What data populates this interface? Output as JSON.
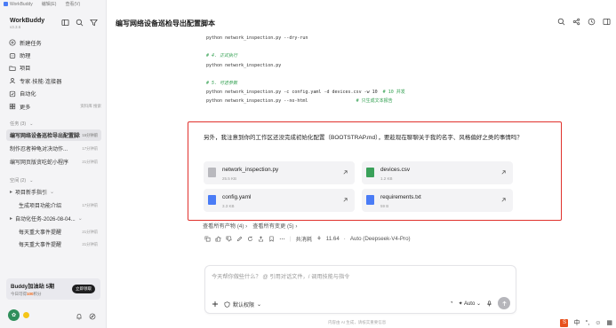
{
  "menubar": {
    "app": "WorkBuddy",
    "edit": "编辑(E)",
    "view": "查看(V)"
  },
  "brand": {
    "name": "WorkBuddy",
    "version": "v3.3.6"
  },
  "nav": [
    {
      "label": "新建任务"
    },
    {
      "label": "助理"
    },
    {
      "label": "项目"
    },
    {
      "label": "专家·技能·连接器"
    },
    {
      "label": "自动化"
    },
    {
      "label": "更多",
      "right": "资料库  搜索"
    }
  ],
  "tasks_header": "任务 (3)",
  "tasks": [
    {
      "title": "编写网络设备巡检导出配置脚本",
      "time": "15分钟前"
    },
    {
      "title": "制作忍者神龟对决动作...",
      "time": "17分钟前"
    },
    {
      "title": "编写网页版贪吃蛇小程序",
      "time": "21分钟前"
    }
  ],
  "space_header": "空间 (2)",
  "spaces": [
    {
      "title": "项目新手指引",
      "time": "",
      "indent": 0
    },
    {
      "title": "生成项目功能介绍",
      "time": "17分钟前",
      "indent": 1
    },
    {
      "title": "自动化任务-2026-08-04...",
      "time": "",
      "indent": 0
    },
    {
      "title": "每天重大事件提醒",
      "time": "21分钟前",
      "indent": 1
    },
    {
      "title": "每天重大事件提醒",
      "time": "21分钟前",
      "indent": 1
    }
  ],
  "promo": {
    "title": "Buddy加油站 5期",
    "sub_prefix": "今日可得",
    "sub_value": "100",
    "sub_suffix": "积分",
    "button": "立即领取"
  },
  "header": {
    "title": "编写网络设备巡检导出配置脚本"
  },
  "code_lines": [
    {
      "text": "python network_inspection.py --dry-run",
      "kind": "code"
    },
    {
      "text": "",
      "kind": "code"
    },
    {
      "text": "# 4. 正式执行",
      "kind": "comment"
    },
    {
      "text": "python network_inspection.py",
      "kind": "code"
    },
    {
      "text": "",
      "kind": "code"
    },
    {
      "text": "# 5. 可选参数",
      "kind": "comment"
    },
    {
      "text": "python network_inspection.py -c config.yaml -d devices.csv -w 10",
      "comment": "  # 10 并发",
      "kind": "mixed"
    },
    {
      "text": "python network_inspection.py --no-html",
      "comment": "                  # 只生成文本报告",
      "kind": "mixed"
    }
  ],
  "message": {
    "text": "另外，我注意到你的工作区还没完成初始化配置（BOOTSTRAP.md），要趁现在聊聊关于我的名字、风格偏好之类的事情吗？"
  },
  "files": [
    {
      "name": "network_inspection.py",
      "size": "25.5 KB",
      "color": "#b9b9be"
    },
    {
      "name": "devices.csv",
      "size": "1.2 KB",
      "color": "#3aa15a"
    },
    {
      "name": "config.yaml",
      "size": "3.3 KB",
      "color": "#4a7cf6"
    },
    {
      "name": "requirements.txt",
      "size": "59 B",
      "color": "#4a7cf6"
    }
  ],
  "links": {
    "artifacts": "查看所有产物 (4)",
    "changes": "查看所有变更 (5)"
  },
  "usage": {
    "label": "共消耗",
    "value": "11.64",
    "model": "Auto (Deepseek-V4-Pro)"
  },
  "input": {
    "placeholder": "今天帮你做些什么？ @ 引用对话文件，/ 调用技能与指令",
    "permission": "默认权限",
    "mode": "Auto"
  },
  "footer": {
    "note": "内容由 AI 生成，请核实重要信息"
  },
  "tray": {
    "ime1": "中",
    "ime2": "°,"
  }
}
